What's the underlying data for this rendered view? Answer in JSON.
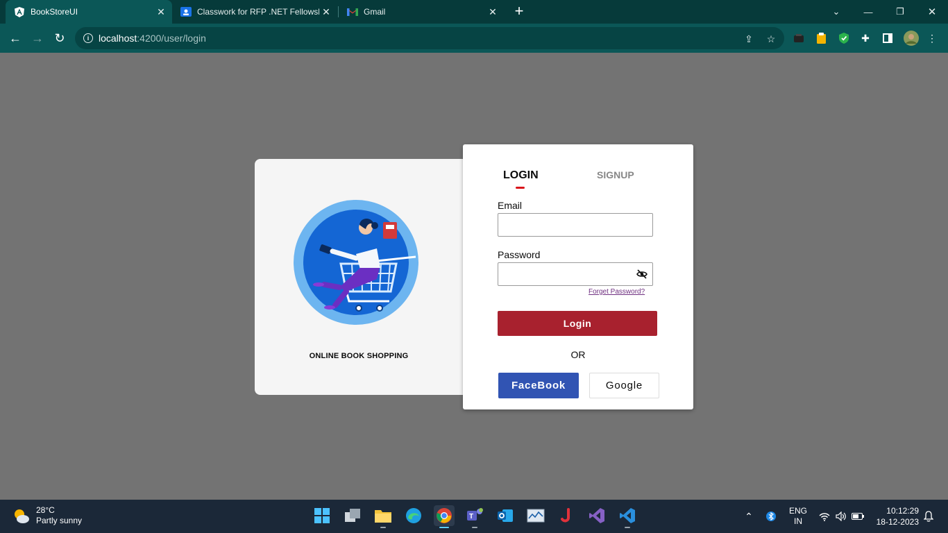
{
  "browser": {
    "tabs": [
      {
        "title": "BookStoreUI",
        "active": true,
        "favicon": "angular-icon"
      },
      {
        "title": "Classwork for RFP .NET Fellowsh",
        "active": false,
        "favicon": "classroom-icon"
      },
      {
        "title": "Gmail",
        "active": false,
        "favicon": "gmail-icon"
      }
    ],
    "url_host": "localhost",
    "url_path": ":4200/user/login",
    "colors": {
      "tabstrip": "#063a3a",
      "toolbar": "#0b5757"
    }
  },
  "left_panel": {
    "caption": "ONLINE BOOK SHOPPING"
  },
  "auth": {
    "login_tab": "LOGIN",
    "signup_tab": "SIGNUP",
    "email_label": "Email",
    "email_value": "",
    "password_label": "Password",
    "password_value": "",
    "forgot_link": "Forget Password?",
    "login_button": "Login",
    "or_text": "OR",
    "facebook_button": "FaceBook",
    "google_button": "Google",
    "colors": {
      "accent": "#a8212e",
      "facebook": "#3154b3",
      "tab_indicator": "#d9151b"
    }
  },
  "taskbar": {
    "weather_temp": "28°C",
    "weather_desc": "Partly sunny",
    "language": "ENG",
    "region": "IN",
    "time": "10:12:29",
    "date": "18-12-2023"
  }
}
